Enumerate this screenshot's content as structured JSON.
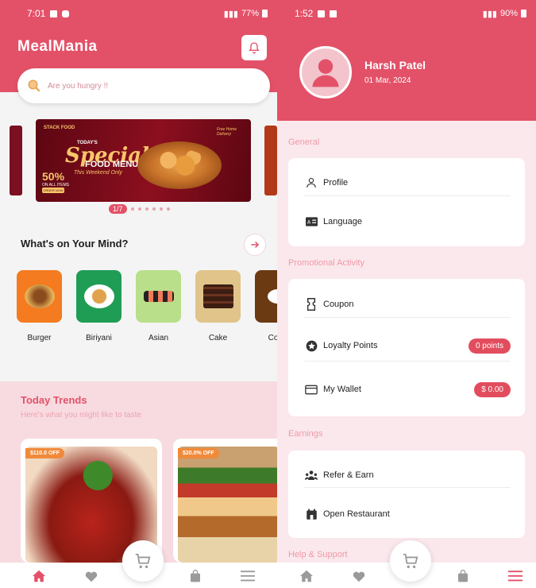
{
  "left": {
    "status": {
      "time": "7:01",
      "battery": "77%"
    },
    "brand": "MealMania",
    "search": {
      "placeholder": "Are you hungry !!"
    },
    "banner": {
      "brand": "STACK FOOD",
      "today": "TODAY'S",
      "special": "Special",
      "menu": "FOOD MENU",
      "weekend": "This Weekend Only",
      "percent": "50%",
      "all_items": "ON ALL ITEMS",
      "order": "ORDER NOW",
      "free": "Free Home Delivery",
      "indicator": "1/7"
    },
    "mind": {
      "title": "What's on Your Mind?"
    },
    "categories": [
      {
        "label": "Burger"
      },
      {
        "label": "Biriyani"
      },
      {
        "label": "Asian"
      },
      {
        "label": "Cake"
      },
      {
        "label": "Coffe"
      }
    ],
    "trends": {
      "title": "Today Trends",
      "subtitle": "Here's what you might like to taste",
      "cards": [
        {
          "badge": "$110.0 OFF"
        },
        {
          "badge": "$20.0% OFF"
        }
      ]
    }
  },
  "right": {
    "status": {
      "time": "1:52",
      "battery": "90%"
    },
    "profile": {
      "name": "Harsh Patel",
      "date": "01 Mar, 2024"
    },
    "sections": {
      "general": "General",
      "promo": "Promotional Activity",
      "earnings": "Earnings",
      "help": "Help & Support"
    },
    "items": {
      "profile": "Profile",
      "language": "Language",
      "coupon": "Coupon",
      "loyalty": "Loyalty Points",
      "loyalty_value": "0 points",
      "wallet": "My Wallet",
      "wallet_value": "$ 0.00",
      "refer": "Refer & Earn",
      "open_restaurant": "Open Restaurant"
    }
  },
  "colors": {
    "accent": "#e35168",
    "pill": "#e24d5e",
    "offer": "#f08a3a"
  }
}
